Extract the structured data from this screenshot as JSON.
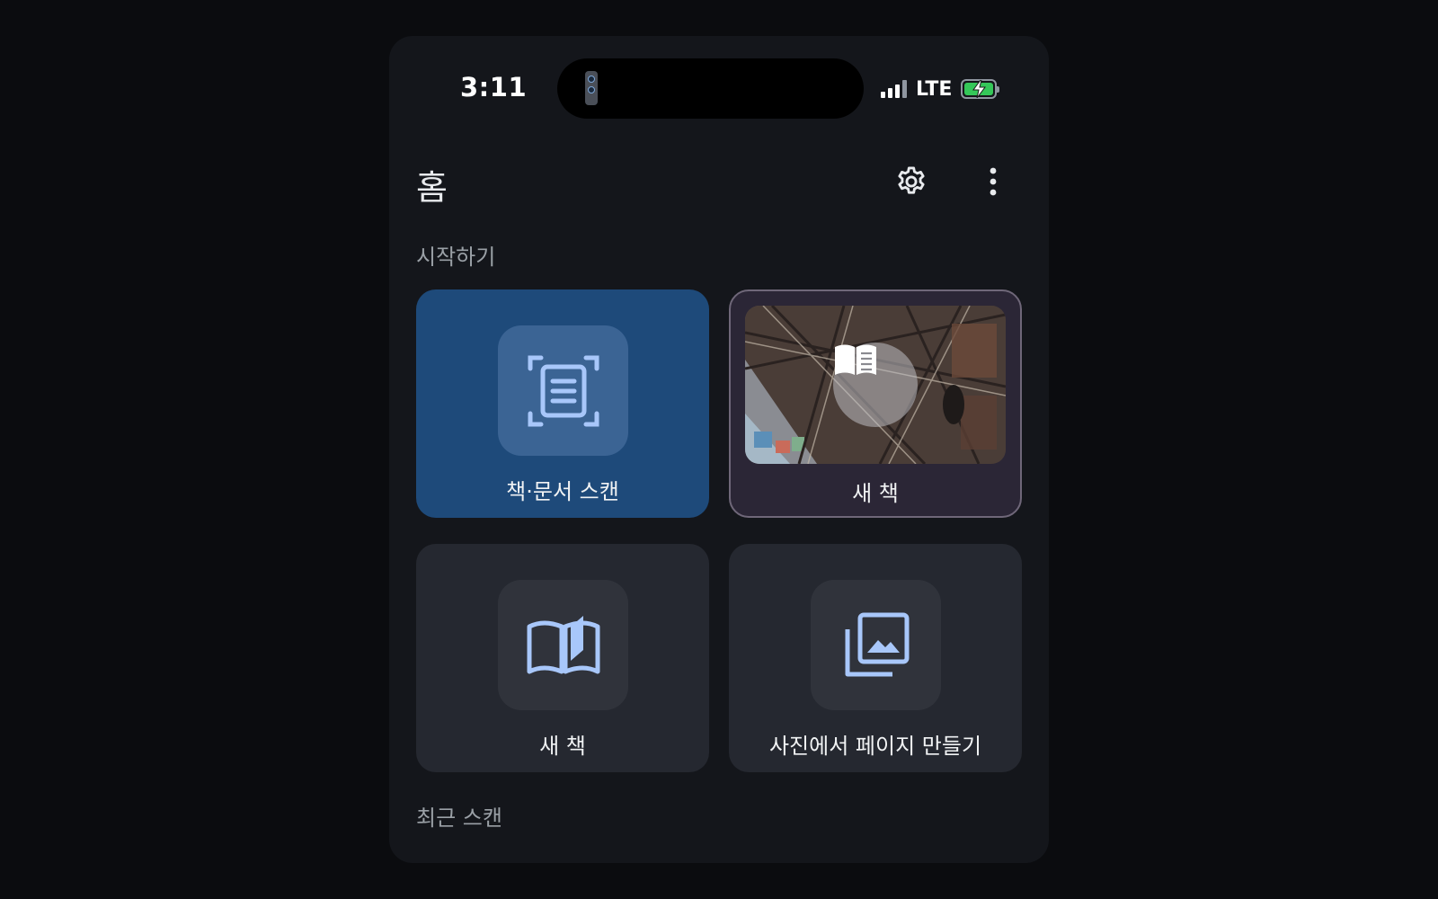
{
  "status_bar": {
    "time": "3:11",
    "network": "LTE",
    "signal_bars": 4,
    "battery_charging": true,
    "battery_color": "#35c759"
  },
  "header": {
    "title": "홈",
    "settings_icon": "gear-icon",
    "more_icon": "more-vert-icon"
  },
  "sections": {
    "start": "시작하기",
    "recent": "최근 스캔"
  },
  "tiles": [
    {
      "label": "책·문서 스캔",
      "icon": "document-scan-icon",
      "bg": "#1e4a7a"
    },
    {
      "label": "새 책",
      "icon": "book-open-icon",
      "bg": "#2b2636"
    },
    {
      "label": "새 책",
      "icon": "book-open-icon",
      "bg": "#252830"
    },
    {
      "label": "사진에서 페이지 만들기",
      "icon": "photo-library-icon",
      "bg": "#252830"
    }
  ],
  "colors": {
    "icon_accent": "#a8c7fa",
    "background": "#14161b"
  }
}
